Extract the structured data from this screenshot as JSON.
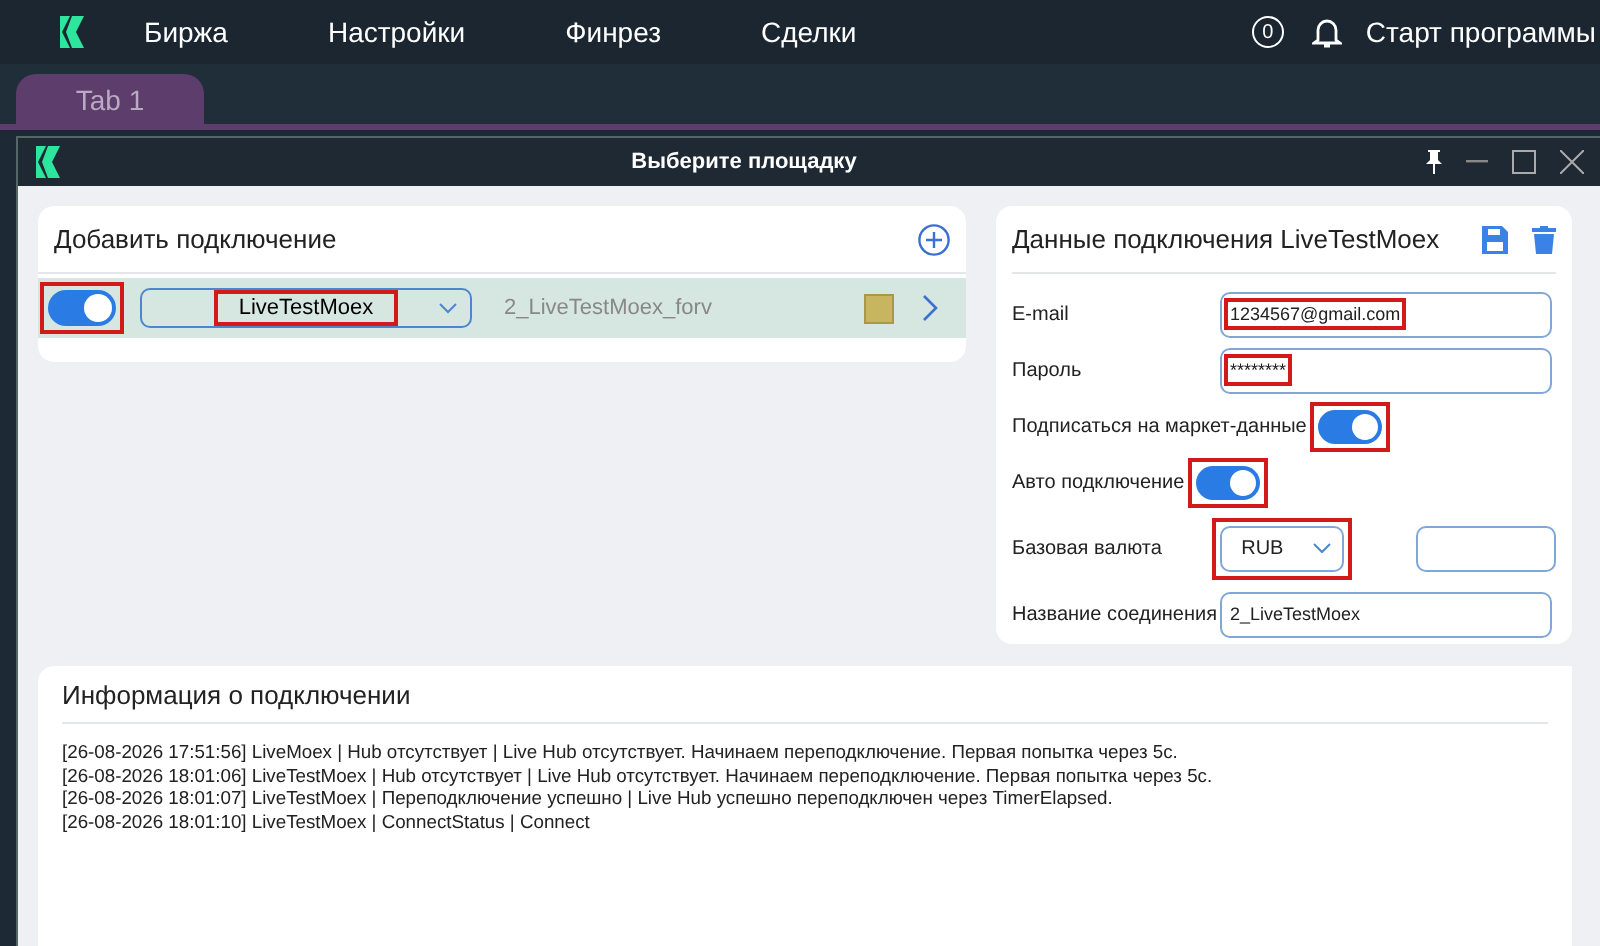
{
  "menu": {
    "items": [
      "Биржа",
      "Настройки",
      "Финрез",
      "Сделки"
    ],
    "notifications": "0",
    "start": "Старт программы"
  },
  "tabs": [
    {
      "label": "Tab 1",
      "selected": true
    }
  ],
  "window": {
    "title": "Выберите площадку"
  },
  "connections": {
    "title": "Добавить подключение",
    "rows": [
      {
        "on": true,
        "on_highlighted": true,
        "exchange": "LiveTestMoex",
        "exchange_highlighted": true,
        "name": "2_LiveTestMoex_forv",
        "color": "#c8b560"
      }
    ]
  },
  "details": {
    "title": "Данные подключения LiveTestMoex",
    "fields": [
      {
        "kind": "text",
        "label": "E-mail",
        "value": "1234567@gmail.com",
        "highlighted": true
      },
      {
        "kind": "text",
        "label": "Пароль",
        "value": "********",
        "highlighted": true
      },
      {
        "kind": "toggle",
        "label": "Подписаться на маркет-данные",
        "on": true,
        "highlighted": true
      },
      {
        "kind": "toggle",
        "label": "Авто подключение",
        "on": true,
        "highlighted": true
      },
      {
        "kind": "select",
        "label": "Базовая валюта",
        "value": "RUB",
        "highlighted": true
      },
      {
        "kind": "text",
        "label": "Название соединения",
        "value": "2_LiveTestMoex"
      }
    ]
  },
  "log": {
    "title": "Информация о подключении",
    "lines": [
      "[26-08-2026 17:51:56] LiveMoex | Hub отсутствует | Live Hub отсутствует. Начинаем переподключение. Первая попытка через 5с.",
      "[26-08-2026 18:01:06] LiveTestMoex | Hub отсутствует | Live Hub отсутствует. Начинаем переподключение. Первая попытка через 5с.",
      "[26-08-2026 18:01:07] LiveTestMoex | Переподключение успешно | Live Hub успешно переподключен через TimerElapsed.",
      "[26-08-2026 18:01:10] LiveTestMoex | ConnectStatus | Connect"
    ]
  }
}
